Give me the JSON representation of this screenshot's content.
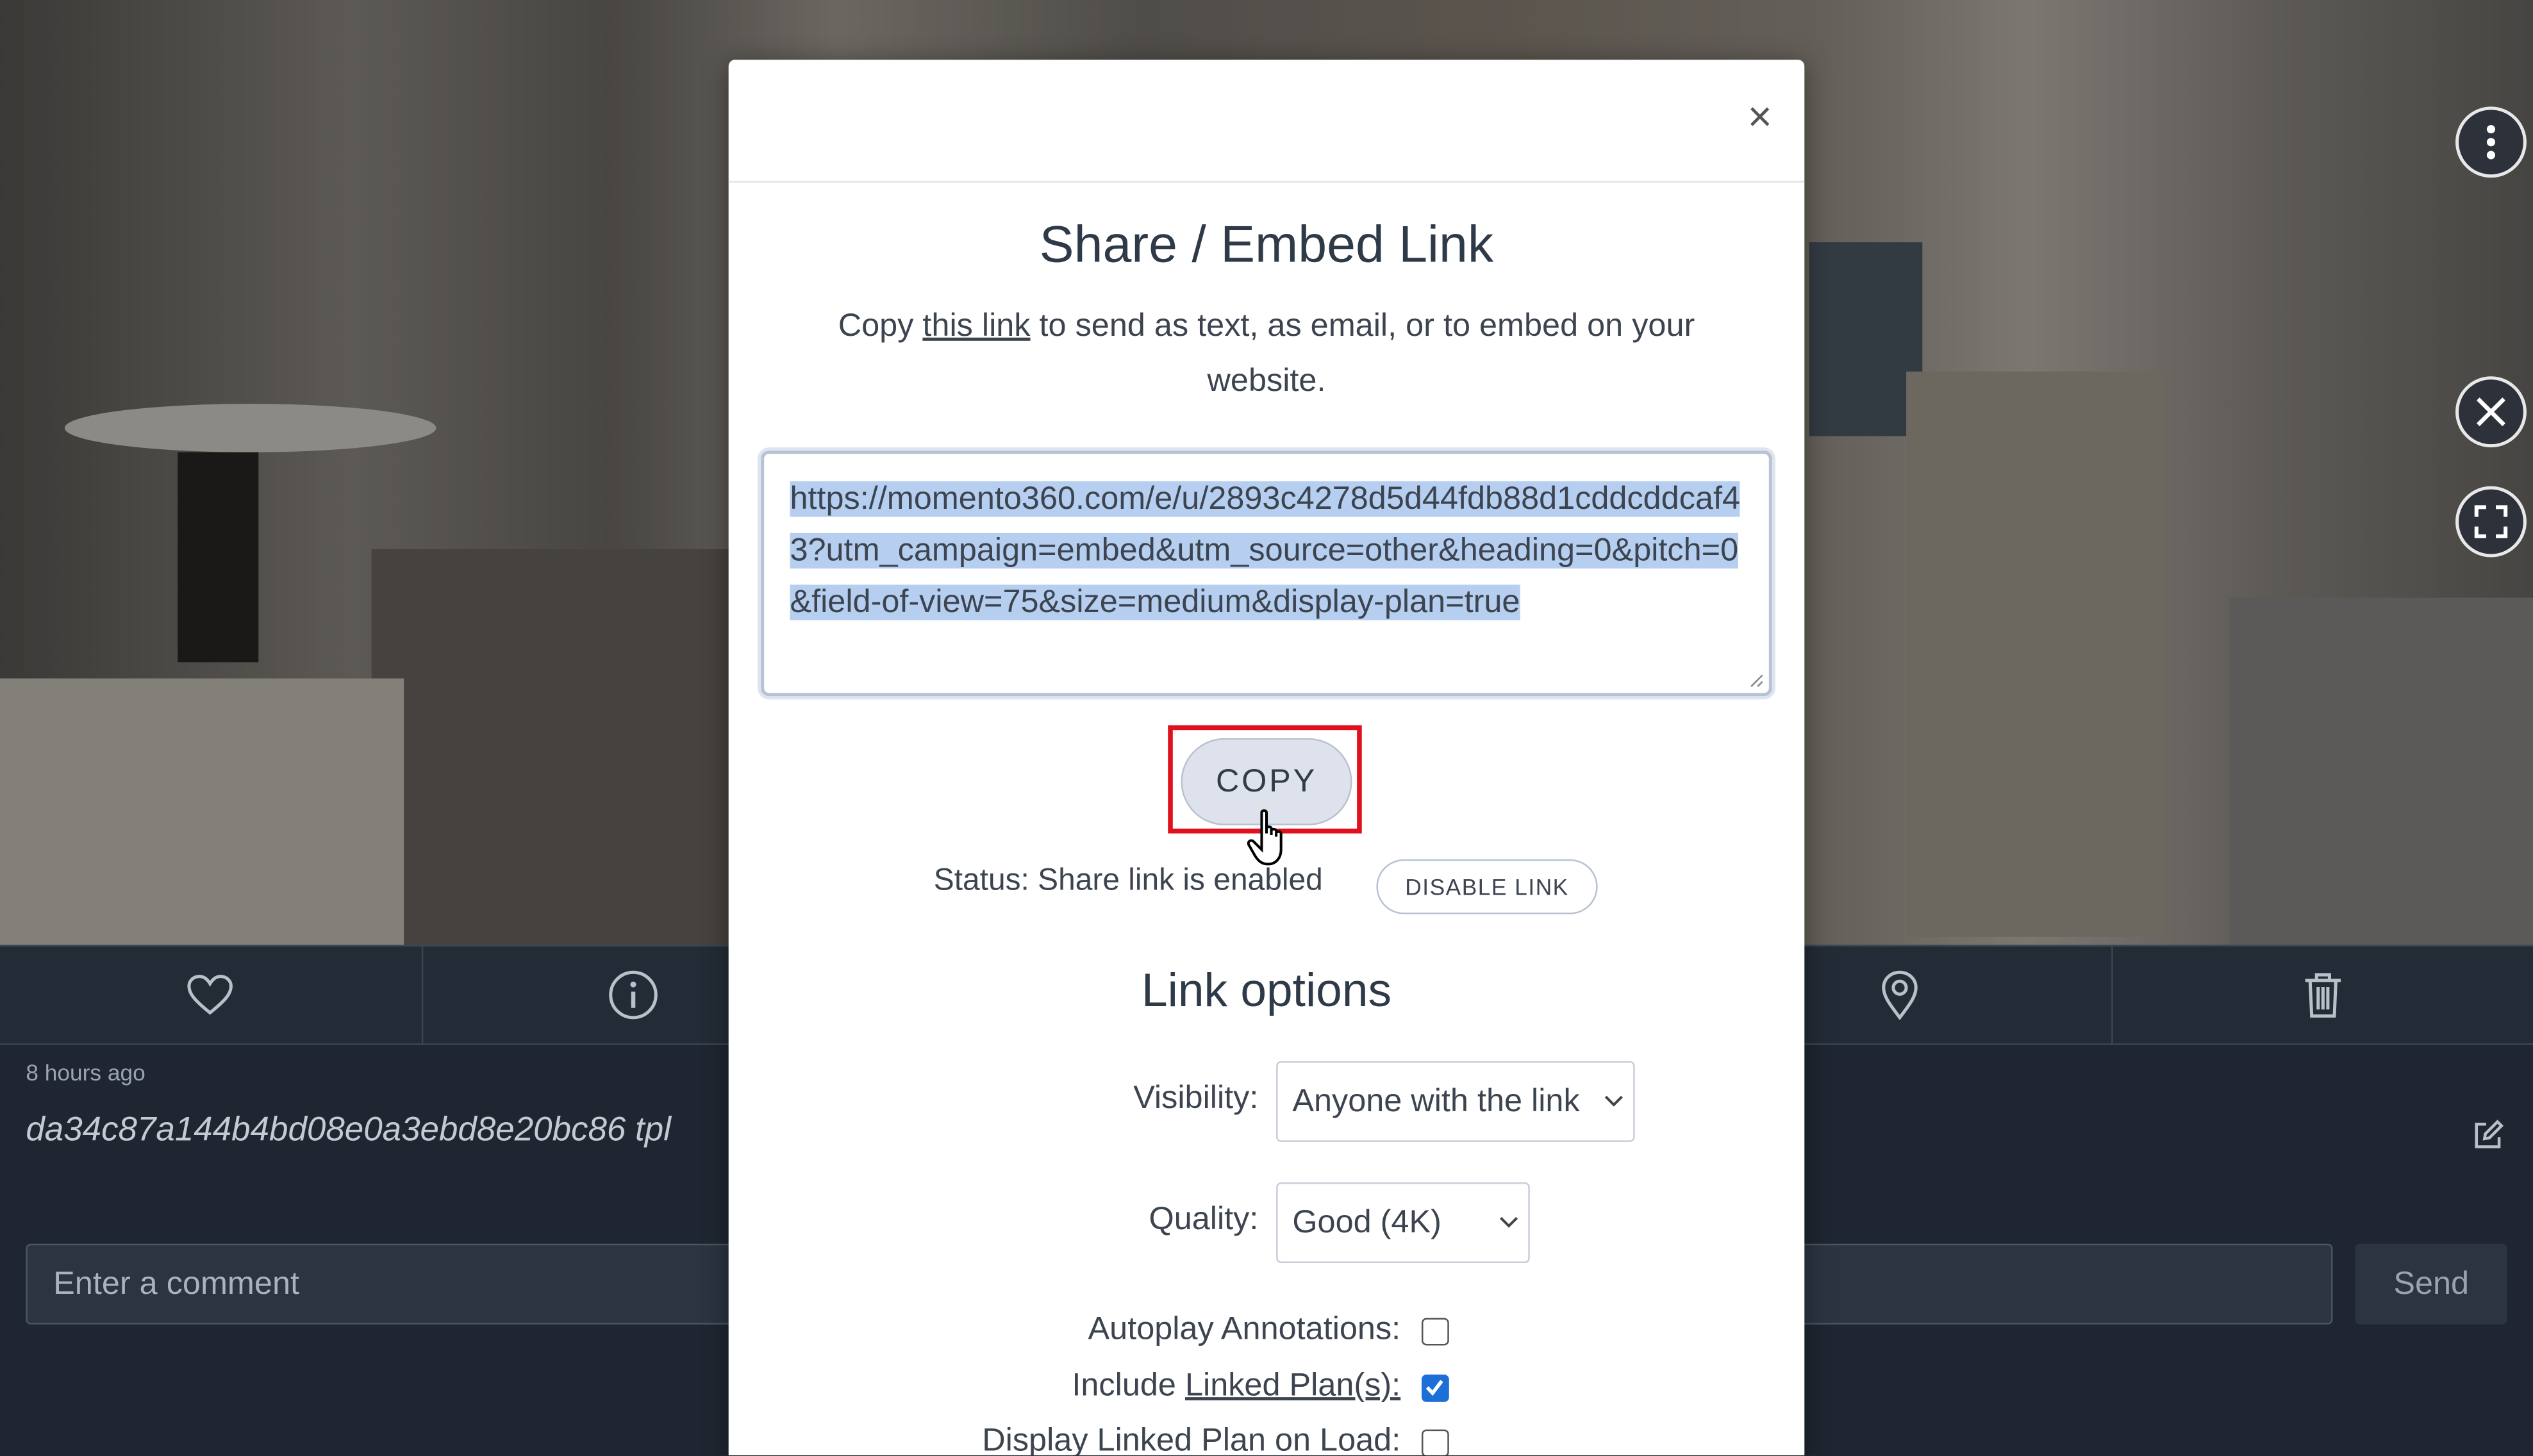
{
  "background": {
    "timestamp": "8 hours ago",
    "filename": "da34c87a144b4bd08e0a3ebd8e20bc86 tpl",
    "comment_placeholder": "Enter a comment",
    "send_label": "Send",
    "action_icons": [
      "heart-icon",
      "info-icon",
      "map-pin-icon",
      "trash-icon"
    ],
    "side_icons": [
      "more-vertical-icon",
      "close-circle-icon",
      "fullscreen-icon"
    ]
  },
  "modal": {
    "close_glyph": "×",
    "title": "Share / Embed Link",
    "desc_before": "Copy ",
    "desc_link": "this link",
    "desc_after": " to send as text, as email, or to embed on your website.",
    "url": "https://momento360.com/e/u/2893c4278d5d44fdb88d1cddcddcaf43?utm_campaign=embed&utm_source=other&heading=0&pitch=0&field-of-view=75&size=medium&display-plan=true",
    "copy_label": "COPY",
    "status_text": "Status: Share link is enabled",
    "disable_label": "DISABLE LINK",
    "options_title": "Link options",
    "visibility_label": "Visibility:",
    "visibility_value": "Anyone with the link",
    "quality_label": "Quality:",
    "quality_value": "Good (4K)",
    "autoplay_label": "Autoplay Annotations:",
    "autoplay_checked": false,
    "include_prefix": "Include ",
    "include_link": "Linked Plan(s):",
    "include_checked": true,
    "display_label": "Display Linked Plan on Load:",
    "display_checked": false
  },
  "colors": {
    "highlight_box": "#e0101c",
    "selection": "#b6cff0",
    "checkbox_checked": "#1d6fd8",
    "dark_bar": "#232b36"
  }
}
